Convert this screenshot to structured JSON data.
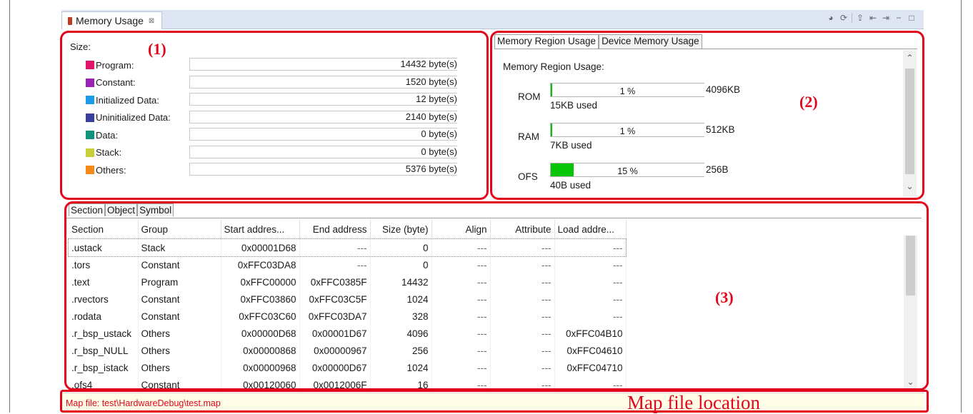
{
  "view": {
    "tab_title": "Memory Usage",
    "tab_close": "⊠"
  },
  "annotations": {
    "label1": "(1)",
    "label2": "(2)",
    "label3": "(3)",
    "map_location": "Map file location"
  },
  "size_panel": {
    "title": "Size:",
    "rows": [
      {
        "label": "Program:",
        "value": "14432",
        "unit": "byte(s)",
        "color": "#e0156a"
      },
      {
        "label": "Constant:",
        "value": "1520",
        "unit": "byte(s)",
        "color": "#9a22b4"
      },
      {
        "label": "Initialized Data:",
        "value": "12",
        "unit": "byte(s)",
        "color": "#1e9be8"
      },
      {
        "label": "Uninitialized Data:",
        "value": "2140",
        "unit": "byte(s)",
        "color": "#3a3f9e"
      },
      {
        "label": "Data:",
        "value": "0",
        "unit": "byte(s)",
        "color": "#10927c"
      },
      {
        "label": "Stack:",
        "value": "0",
        "unit": "byte(s)",
        "color": "#c7cf3b"
      },
      {
        "label": "Others:",
        "value": "5376",
        "unit": "byte(s)",
        "color": "#f48a1a"
      }
    ]
  },
  "region_tabs": [
    "Memory Region Usage",
    "Device Memory Usage"
  ],
  "region_panel": {
    "title": "Memory Region Usage:",
    "regions": [
      {
        "name": "ROM",
        "percent_text": "1 %",
        "fill_fraction": 0.01,
        "total": "4096KB",
        "used": "15KB used"
      },
      {
        "name": "RAM",
        "percent_text": "1 %",
        "fill_fraction": 0.01,
        "total": "512KB",
        "used": "7KB used"
      },
      {
        "name": "OFS",
        "percent_text": "15 %",
        "fill_fraction": 0.15,
        "total": "256B",
        "used": "40B used"
      }
    ]
  },
  "section_tabs": [
    "Section",
    "Object",
    "Symbol"
  ],
  "section_table": {
    "headers": [
      "Section",
      "Group",
      "Start addres...",
      "End address",
      "Size (byte)",
      "Align",
      "Attribute",
      "Load addre..."
    ],
    "rows": [
      [
        ".ustack",
        "Stack",
        "0x00001D68",
        "---",
        "0",
        "---",
        "---",
        "---"
      ],
      [
        ".tors",
        "Constant",
        "0xFFC03DA8",
        "---",
        "0",
        "---",
        "---",
        "---"
      ],
      [
        ".text",
        "Program",
        "0xFFC00000",
        "0xFFC0385F",
        "14432",
        "---",
        "---",
        "---"
      ],
      [
        ".rvectors",
        "Constant",
        "0xFFC03860",
        "0xFFC03C5F",
        "1024",
        "---",
        "---",
        "---"
      ],
      [
        ".rodata",
        "Constant",
        "0xFFC03C60",
        "0xFFC03DA7",
        "328",
        "---",
        "---",
        "---"
      ],
      [
        ".r_bsp_ustack",
        "Others",
        "0x00000D68",
        "0x00001D67",
        "4096",
        "---",
        "---",
        "0xFFC04B10"
      ],
      [
        ".r_bsp_NULL",
        "Others",
        "0x00000868",
        "0x00000967",
        "256",
        "---",
        "---",
        "0xFFC04610"
      ],
      [
        ".r_bsp_istack",
        "Others",
        "0x00000968",
        "0x00000D67",
        "1024",
        "---",
        "---",
        "0xFFC04710"
      ],
      [
        ".ofs4",
        "Constant",
        "0x00120060",
        "0x0012006F",
        "16",
        "---",
        "---",
        "---"
      ]
    ]
  },
  "map_file": "Map file: test\\HardwareDebug\\test.map"
}
